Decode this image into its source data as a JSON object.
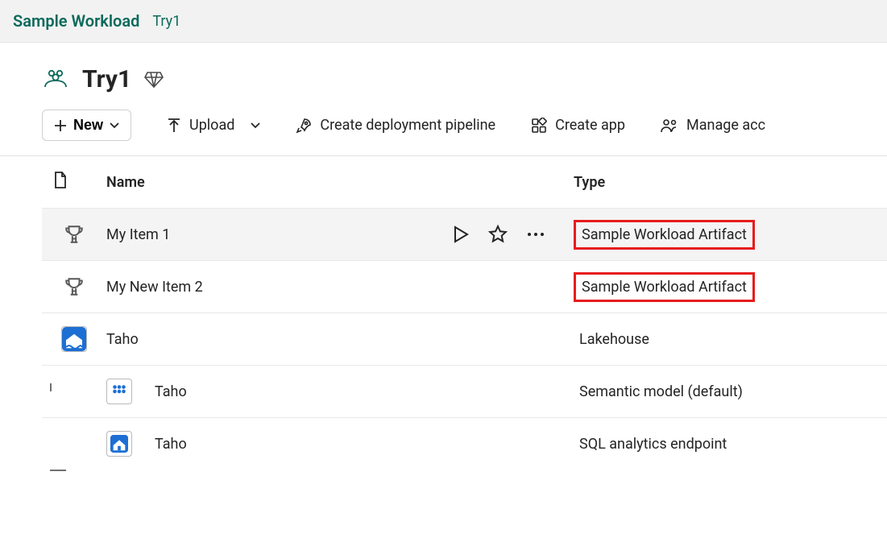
{
  "breadcrumb": {
    "brand": "Sample Workload",
    "page": "Try1"
  },
  "workspace": {
    "name": "Try1",
    "icon": "people-icon",
    "premium_icon": "diamond-icon"
  },
  "toolbar": {
    "new_label": "New",
    "upload_label": "Upload",
    "pipeline_label": "Create deployment pipeline",
    "create_app_label": "Create app",
    "manage_access_label": "Manage acc"
  },
  "table": {
    "header": {
      "name": "Name",
      "type": "Type"
    },
    "rows": [
      {
        "icon": "trophy-icon",
        "name": "My Item 1",
        "type": "Sample Workload Artifact",
        "highlight_type": true,
        "hovered": true
      },
      {
        "icon": "trophy-icon",
        "name": "My New Item 2",
        "type": "Sample Workload Artifact",
        "highlight_type": true
      },
      {
        "icon": "lakehouse-icon",
        "name": "Taho",
        "type": "Lakehouse"
      },
      {
        "child": true,
        "icon": "semantic-model-icon",
        "name": "Taho",
        "type": "Semantic model (default)"
      },
      {
        "child": true,
        "last_child": true,
        "icon": "sql-endpoint-icon",
        "name": "Taho",
        "type": "SQL analytics endpoint"
      }
    ]
  }
}
